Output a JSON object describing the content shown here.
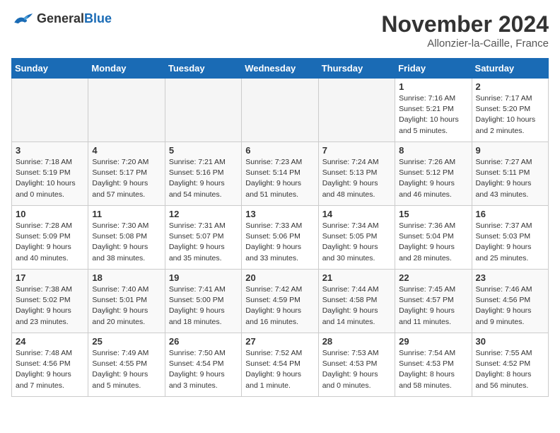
{
  "header": {
    "logo_line1": "General",
    "logo_line2": "Blue",
    "month": "November 2024",
    "location": "Allonzier-la-Caille, France"
  },
  "weekdays": [
    "Sunday",
    "Monday",
    "Tuesday",
    "Wednesday",
    "Thursday",
    "Friday",
    "Saturday"
  ],
  "weeks": [
    [
      {
        "day": "",
        "info": ""
      },
      {
        "day": "",
        "info": ""
      },
      {
        "day": "",
        "info": ""
      },
      {
        "day": "",
        "info": ""
      },
      {
        "day": "",
        "info": ""
      },
      {
        "day": "1",
        "info": "Sunrise: 7:16 AM\nSunset: 5:21 PM\nDaylight: 10 hours and 5 minutes."
      },
      {
        "day": "2",
        "info": "Sunrise: 7:17 AM\nSunset: 5:20 PM\nDaylight: 10 hours and 2 minutes."
      }
    ],
    [
      {
        "day": "3",
        "info": "Sunrise: 7:18 AM\nSunset: 5:19 PM\nDaylight: 10 hours and 0 minutes."
      },
      {
        "day": "4",
        "info": "Sunrise: 7:20 AM\nSunset: 5:17 PM\nDaylight: 9 hours and 57 minutes."
      },
      {
        "day": "5",
        "info": "Sunrise: 7:21 AM\nSunset: 5:16 PM\nDaylight: 9 hours and 54 minutes."
      },
      {
        "day": "6",
        "info": "Sunrise: 7:23 AM\nSunset: 5:14 PM\nDaylight: 9 hours and 51 minutes."
      },
      {
        "day": "7",
        "info": "Sunrise: 7:24 AM\nSunset: 5:13 PM\nDaylight: 9 hours and 48 minutes."
      },
      {
        "day": "8",
        "info": "Sunrise: 7:26 AM\nSunset: 5:12 PM\nDaylight: 9 hours and 46 minutes."
      },
      {
        "day": "9",
        "info": "Sunrise: 7:27 AM\nSunset: 5:11 PM\nDaylight: 9 hours and 43 minutes."
      }
    ],
    [
      {
        "day": "10",
        "info": "Sunrise: 7:28 AM\nSunset: 5:09 PM\nDaylight: 9 hours and 40 minutes."
      },
      {
        "day": "11",
        "info": "Sunrise: 7:30 AM\nSunset: 5:08 PM\nDaylight: 9 hours and 38 minutes."
      },
      {
        "day": "12",
        "info": "Sunrise: 7:31 AM\nSunset: 5:07 PM\nDaylight: 9 hours and 35 minutes."
      },
      {
        "day": "13",
        "info": "Sunrise: 7:33 AM\nSunset: 5:06 PM\nDaylight: 9 hours and 33 minutes."
      },
      {
        "day": "14",
        "info": "Sunrise: 7:34 AM\nSunset: 5:05 PM\nDaylight: 9 hours and 30 minutes."
      },
      {
        "day": "15",
        "info": "Sunrise: 7:36 AM\nSunset: 5:04 PM\nDaylight: 9 hours and 28 minutes."
      },
      {
        "day": "16",
        "info": "Sunrise: 7:37 AM\nSunset: 5:03 PM\nDaylight: 9 hours and 25 minutes."
      }
    ],
    [
      {
        "day": "17",
        "info": "Sunrise: 7:38 AM\nSunset: 5:02 PM\nDaylight: 9 hours and 23 minutes."
      },
      {
        "day": "18",
        "info": "Sunrise: 7:40 AM\nSunset: 5:01 PM\nDaylight: 9 hours and 20 minutes."
      },
      {
        "day": "19",
        "info": "Sunrise: 7:41 AM\nSunset: 5:00 PM\nDaylight: 9 hours and 18 minutes."
      },
      {
        "day": "20",
        "info": "Sunrise: 7:42 AM\nSunset: 4:59 PM\nDaylight: 9 hours and 16 minutes."
      },
      {
        "day": "21",
        "info": "Sunrise: 7:44 AM\nSunset: 4:58 PM\nDaylight: 9 hours and 14 minutes."
      },
      {
        "day": "22",
        "info": "Sunrise: 7:45 AM\nSunset: 4:57 PM\nDaylight: 9 hours and 11 minutes."
      },
      {
        "day": "23",
        "info": "Sunrise: 7:46 AM\nSunset: 4:56 PM\nDaylight: 9 hours and 9 minutes."
      }
    ],
    [
      {
        "day": "24",
        "info": "Sunrise: 7:48 AM\nSunset: 4:56 PM\nDaylight: 9 hours and 7 minutes."
      },
      {
        "day": "25",
        "info": "Sunrise: 7:49 AM\nSunset: 4:55 PM\nDaylight: 9 hours and 5 minutes."
      },
      {
        "day": "26",
        "info": "Sunrise: 7:50 AM\nSunset: 4:54 PM\nDaylight: 9 hours and 3 minutes."
      },
      {
        "day": "27",
        "info": "Sunrise: 7:52 AM\nSunset: 4:54 PM\nDaylight: 9 hours and 1 minute."
      },
      {
        "day": "28",
        "info": "Sunrise: 7:53 AM\nSunset: 4:53 PM\nDaylight: 9 hours and 0 minutes."
      },
      {
        "day": "29",
        "info": "Sunrise: 7:54 AM\nSunset: 4:53 PM\nDaylight: 8 hours and 58 minutes."
      },
      {
        "day": "30",
        "info": "Sunrise: 7:55 AM\nSunset: 4:52 PM\nDaylight: 8 hours and 56 minutes."
      }
    ]
  ]
}
